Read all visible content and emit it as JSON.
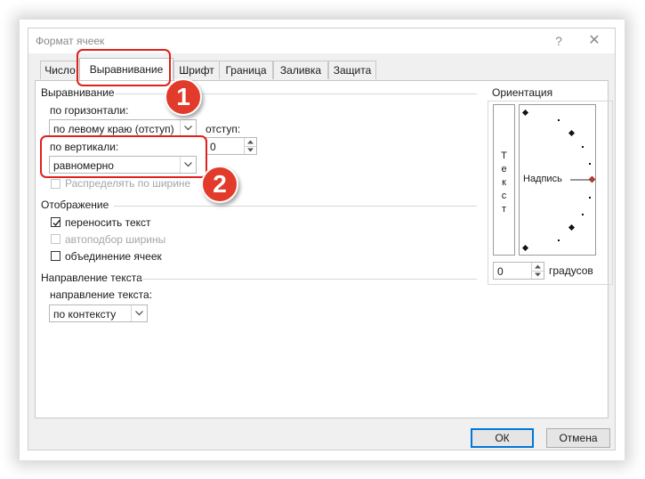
{
  "window": {
    "title": "Формат ячеек",
    "help_glyph": "?",
    "close_glyph": "✕"
  },
  "tabs": [
    {
      "label": "Число"
    },
    {
      "label": "Выравнивание",
      "active": true
    },
    {
      "label": "Шрифт"
    },
    {
      "label": "Граница"
    },
    {
      "label": "Заливка"
    },
    {
      "label": "Защита"
    }
  ],
  "alignment": {
    "group_label": "Выравнивание",
    "horizontal_label": "по горизонтали:",
    "horizontal_value": "по левому краю (отступ)",
    "indent_label": "отступ:",
    "indent_value": "0",
    "vertical_label": "по вертикали:",
    "vertical_value": "равномерно",
    "distribute_label": "Распределять по ширине"
  },
  "display": {
    "group_label": "Отображение",
    "wrap_text": {
      "label": "переносить текст",
      "checked": true
    },
    "shrink_to_fit": {
      "label": "автоподбор ширины",
      "checked": false
    },
    "merge_cells": {
      "label": "объединение ячеек",
      "checked": false
    }
  },
  "direction": {
    "group_label": "Направление текста",
    "label": "направление текста:",
    "value": "по контексту"
  },
  "orientation": {
    "group_label": "Ориентация",
    "vertical_text": [
      "Т",
      "е",
      "к",
      "с",
      "т"
    ],
    "dial_label": "Надпись",
    "degrees_value": "0",
    "degrees_label": "градусов"
  },
  "buttons": {
    "ok": "ОК",
    "cancel": "Отмена"
  },
  "annotations": {
    "badge_1": "1",
    "badge_2": "2",
    "highlight_color": "#e0201c"
  }
}
